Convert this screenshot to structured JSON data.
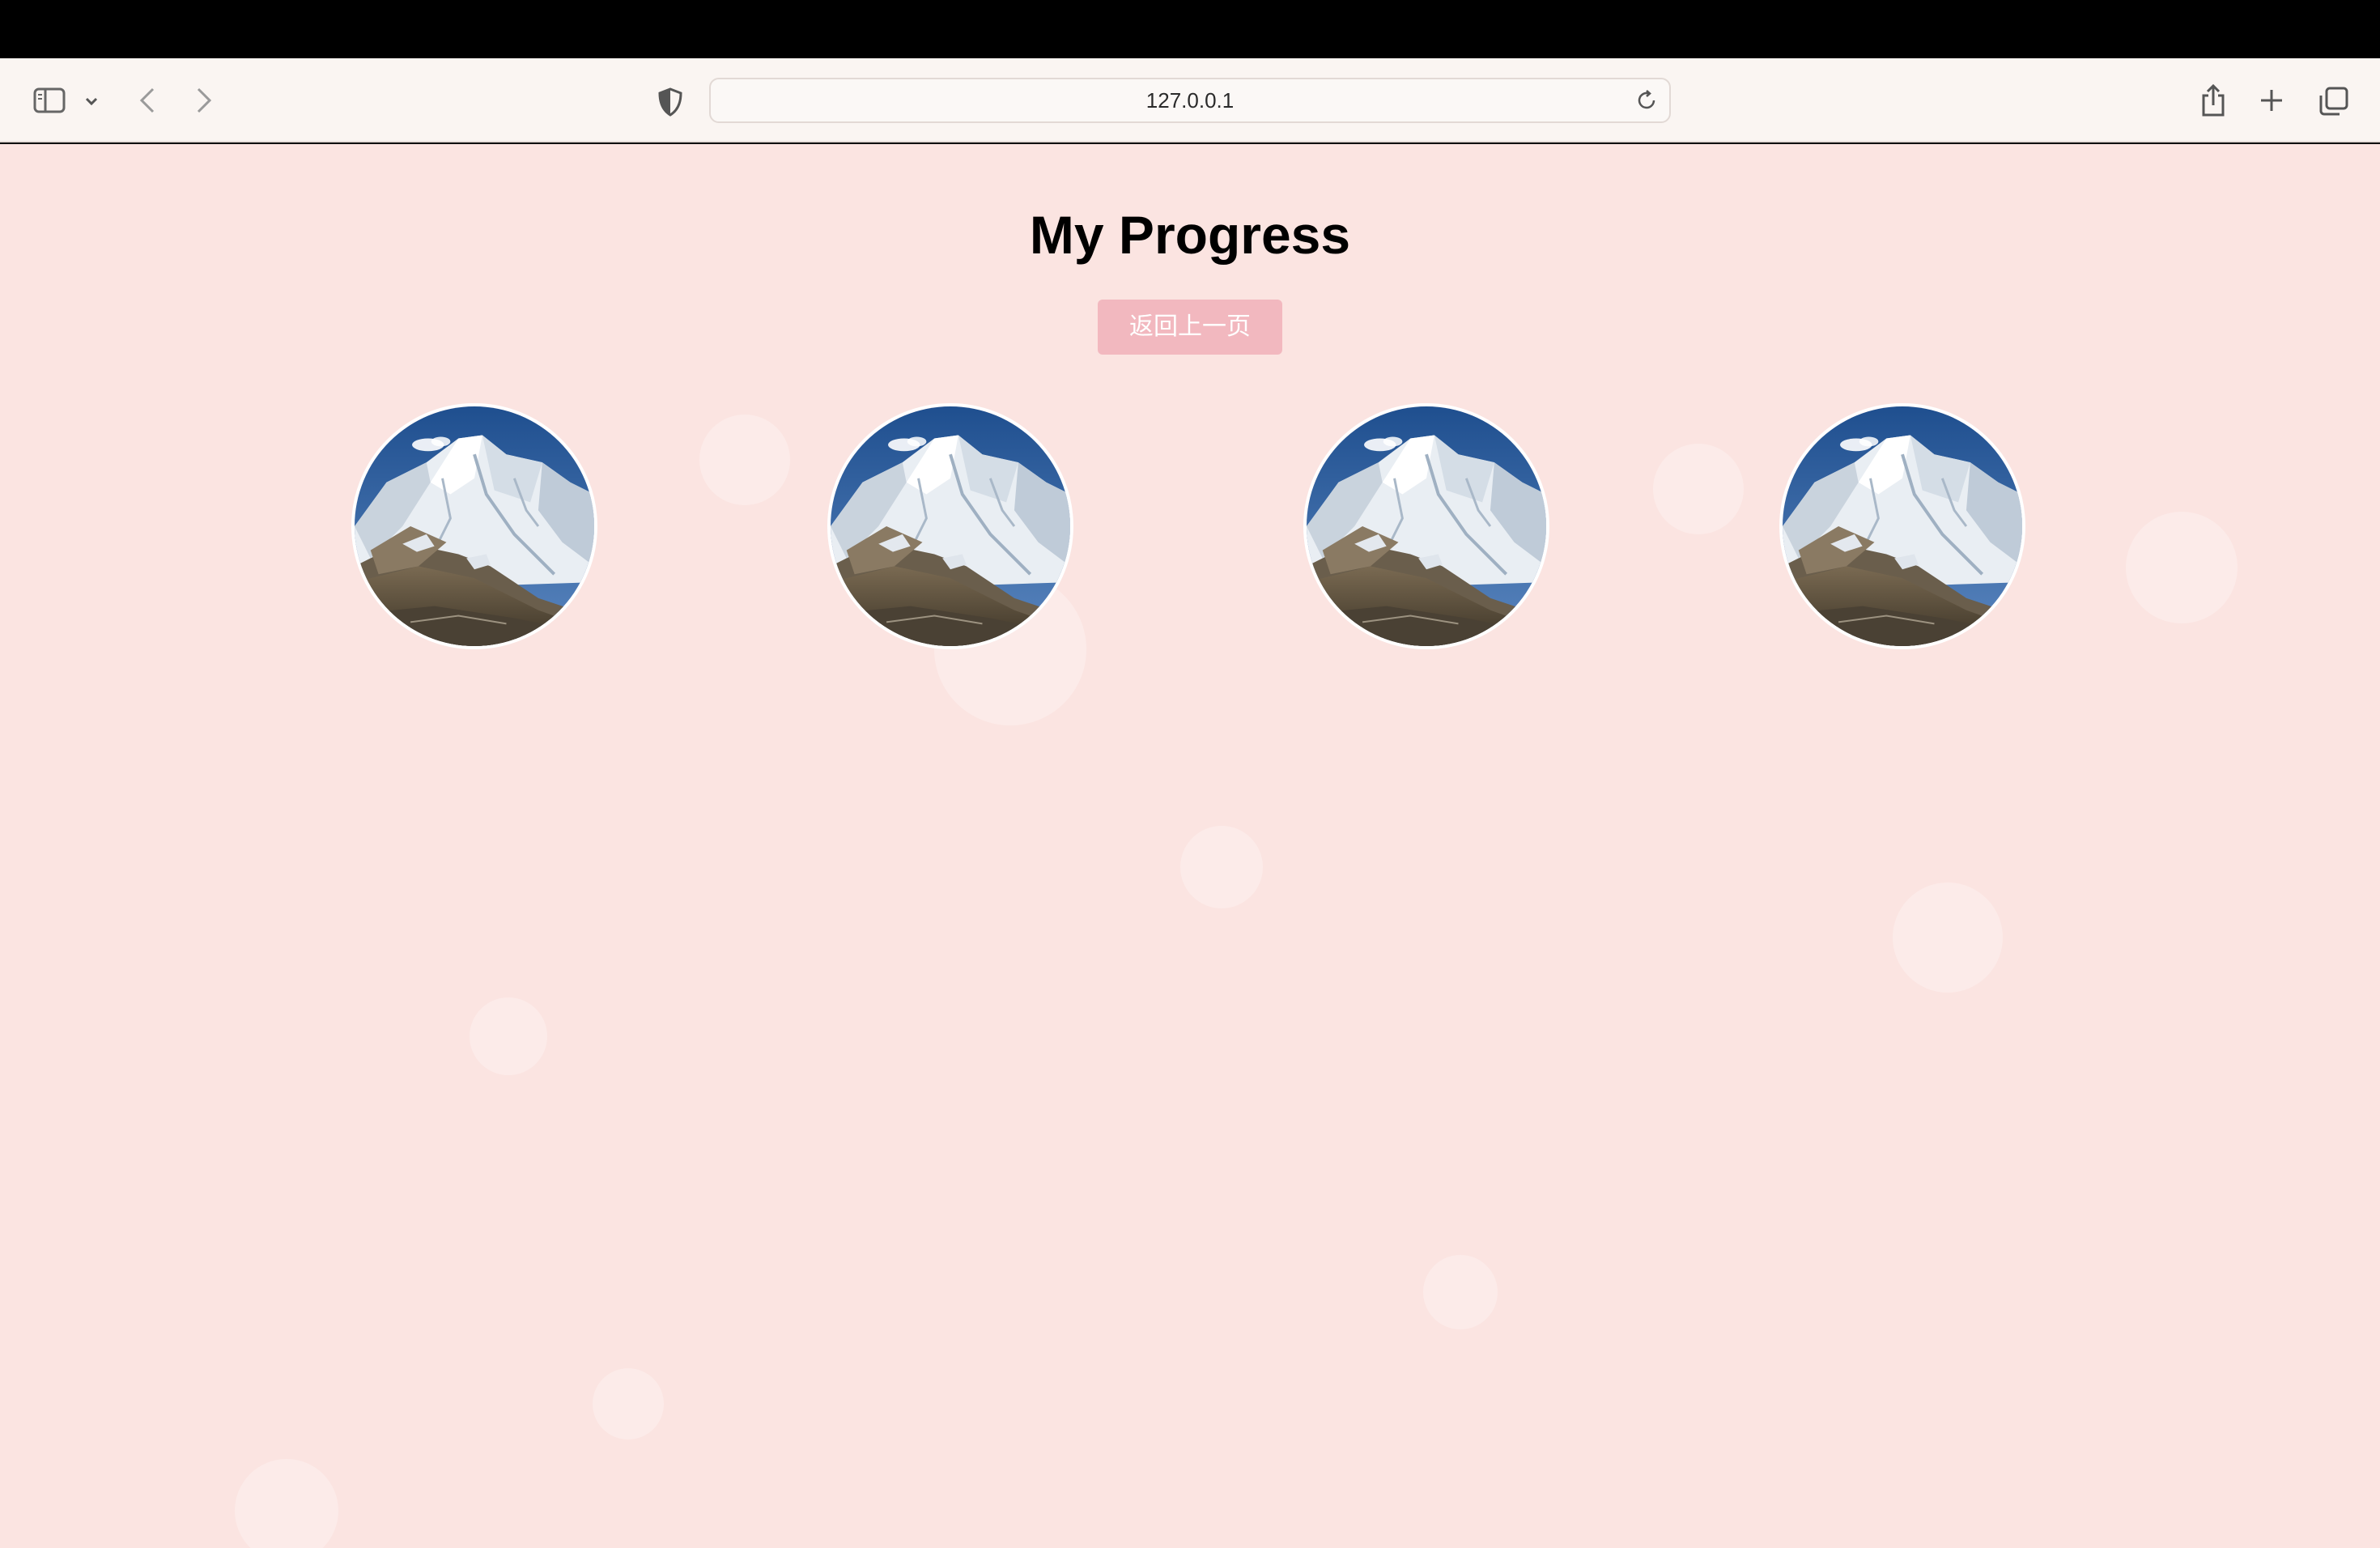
{
  "browser": {
    "url": "127.0.0.1",
    "icons": [
      "sidebar-icon",
      "chevron-down-icon",
      "back-arrow-icon",
      "forward-arrow-icon",
      "privacy-shield-icon",
      "reload-icon",
      "share-icon",
      "new-tab-plus-icon",
      "tab-overview-icon"
    ]
  },
  "page": {
    "title": "My Progress",
    "back_button_label": "返回上一页",
    "background_color": "#fbe4e1",
    "button_color": "#f2b8bf",
    "progress_images": [
      {
        "icon": "mountain-image"
      },
      {
        "icon": "mountain-image"
      },
      {
        "icon": "mountain-image"
      },
      {
        "icon": "mountain-image"
      }
    ]
  }
}
